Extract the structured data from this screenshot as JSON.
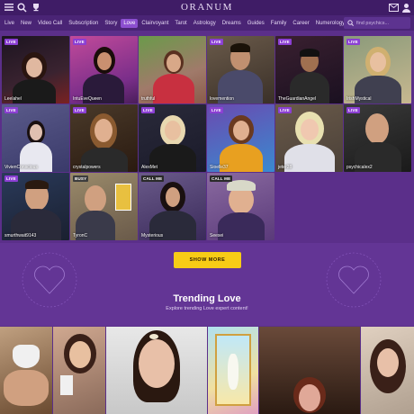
{
  "header": {
    "logo": "ORANUM",
    "icons": [
      "menu-icon",
      "search-icon",
      "trophy-icon",
      "mail-icon",
      "user-icon"
    ]
  },
  "categories": [
    {
      "label": "Live",
      "active": false
    },
    {
      "label": "New",
      "active": false
    },
    {
      "label": "Video Call",
      "active": false
    },
    {
      "label": "Subscription",
      "active": false
    },
    {
      "label": "Story",
      "active": false
    },
    {
      "label": "Love",
      "active": true
    },
    {
      "label": "Clairvoyant",
      "active": false
    },
    {
      "label": "Tarot",
      "active": false
    },
    {
      "label": "Astrology",
      "active": false
    },
    {
      "label": "Dreams",
      "active": false
    },
    {
      "label": "Guides",
      "active": false
    },
    {
      "label": "Family",
      "active": false
    },
    {
      "label": "Career",
      "active": false
    },
    {
      "label": "Numerology",
      "active": false
    }
  ],
  "search": {
    "placeholder": "find psychics..."
  },
  "experts": [
    {
      "name": "Leelahel",
      "badge": "LIVE"
    },
    {
      "name": "IntuEveQueen",
      "badge": "LIVE"
    },
    {
      "name": "truthful",
      "badge": ""
    },
    {
      "name": "lovemention",
      "badge": "LIVE"
    },
    {
      "name": "TheGuardianAngel",
      "badge": "LIVE"
    },
    {
      "name": "IrishMystical",
      "badge": "LIVE"
    },
    {
      "name": "VivienConscious",
      "badge": "LIVE"
    },
    {
      "name": "crystalpowers",
      "badge": "LIVE"
    },
    {
      "name": "AlexMet",
      "badge": "LIVE"
    },
    {
      "name": "Sioelle37",
      "badge": "LIVE"
    },
    {
      "name": "jeter28",
      "badge": "LIVE"
    },
    {
      "name": "psychicalex2",
      "badge": "LIVE"
    },
    {
      "name": "smurthwait9143",
      "badge": "LIVE"
    },
    {
      "name": "TyronC",
      "badge": "BUSY"
    },
    {
      "name": "Mysterious",
      "badge": "CALL ME"
    },
    {
      "name": "Seesei",
      "badge": "CALL ME"
    }
  ],
  "show_more": "SHOW MORE",
  "trending": {
    "title": "Trending Love",
    "subtitle": "Explore trending Love expert content!"
  }
}
